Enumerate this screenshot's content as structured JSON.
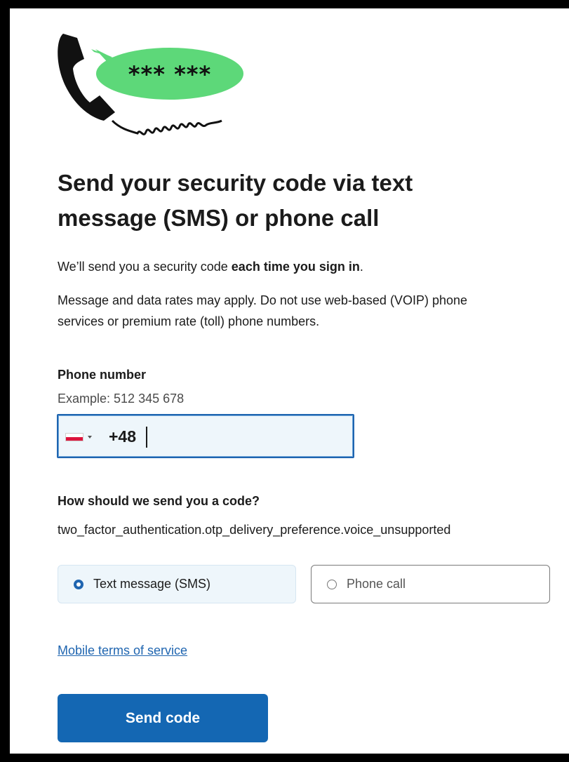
{
  "illustration": {
    "code_mask": "*** ***"
  },
  "title": "Send your security code via text message (SMS) or phone call",
  "lead": {
    "prefix": "We’ll send you a security code ",
    "bold": "each time you sign in",
    "suffix": "."
  },
  "notice": "Message and data rates may apply. Do not use web-based (VOIP) phone services or premium rate (toll) phone numbers.",
  "phone": {
    "label": "Phone number",
    "hint": "Example: 512 345 678",
    "country_flag": "flag-icon-poland",
    "dial_code": "+48",
    "value": ""
  },
  "delivery": {
    "label": "How should we send you a code?",
    "unsupported_key": "two_factor_authentication.otp_delivery_preference.voice_unsupported",
    "options": [
      {
        "label": "Text message (SMS)",
        "selected": true
      },
      {
        "label": "Phone call",
        "selected": false
      }
    ]
  },
  "terms_link": "Mobile terms of service",
  "submit_label": "Send code",
  "colors": {
    "accent": "#1467b3",
    "bubble": "#5dd879",
    "field_bg": "#eef6fb"
  }
}
